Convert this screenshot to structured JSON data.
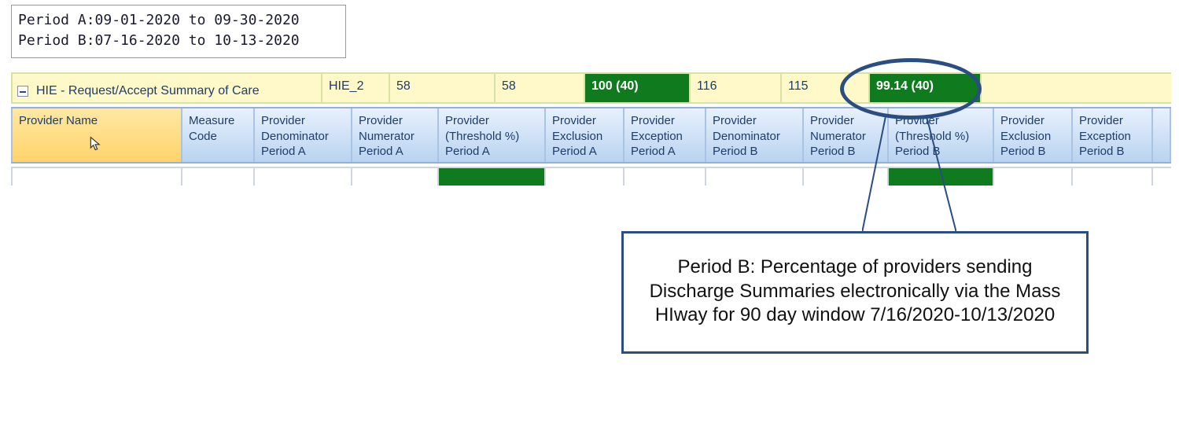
{
  "periods": {
    "a_label": "Period A:09-01-2020 to 09-30-2020",
    "b_label": "Period B:07-16-2020 to 10-13-2020"
  },
  "summary": {
    "title": "HIE - Request/Accept Summary of Care",
    "measure_code": "HIE_2",
    "denomA": "58",
    "numerA": "58",
    "threshA": "100 (40)",
    "denomB": "116",
    "numerB": "115",
    "threshB": "99.14 (40)"
  },
  "headers": {
    "c0": "Provider Name",
    "c1": "Measure Code",
    "c2": "Provider Denominator Period A",
    "c3": "Provider Numerator Period A",
    "c4": "Provider (Threshold %) Period A",
    "c5": "Provider Exclusion Period A",
    "c6": "Provider Exception Period A",
    "c7": "Provider Denominator Period B",
    "c8": "Provider Numerator Period B",
    "c9": "Provider (Threshold %) Period B",
    "c10": "Provider Exclusion Period B",
    "c11": "Provider Exception Period B"
  },
  "callout": {
    "text": "Period B: Percentage of providers sending Discharge Summaries electronically via the Mass HIway for 90 day window 7/16/2020-10/13/2020"
  }
}
